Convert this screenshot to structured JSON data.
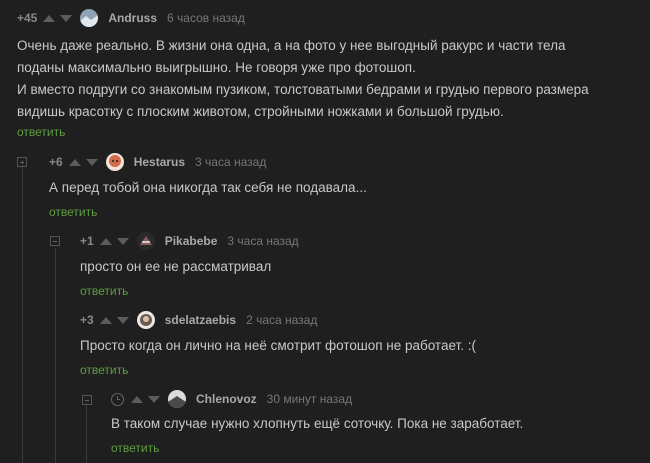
{
  "comments": [
    {
      "score": "+45",
      "author": "Andruss",
      "time": "6 часов назад",
      "lines": [
        "Очень даже реально. В жизни она одна, а на фото у нее выгодный ракурс и части тела",
        "поданы максимально выигрышно. Не говоря уже про фотошоп.",
        "И вместо подруги со знакомым пузиком, толстоватыми бедрами и грудью первого размера",
        "видишь красотку с плоским животом, стройными ножками и большой грудью."
      ],
      "reply": "ответить"
    },
    {
      "score": "+6",
      "author": "Hestarus",
      "time": "3 часа назад",
      "lines": [
        "А перед тобой она никогда так себя не подавала..."
      ],
      "reply": "ответить"
    },
    {
      "score": "+1",
      "author": "Pikabebe",
      "time": "3 часа назад",
      "lines": [
        "просто он ее не рассматривал"
      ],
      "reply": "ответить"
    },
    {
      "score": "+3",
      "author": "sdelatzaebis",
      "time": "2 часа назад",
      "lines": [
        "Просто когда он лично на неё смотрит фотошоп не работает. :("
      ],
      "reply": "ответить"
    },
    {
      "score": "",
      "author": "Chlenovoz",
      "time": "30 минут назад",
      "lines": [
        "В таком случае нужно хлопнуть ещё соточку. Пока не заработает."
      ],
      "reply": "ответить"
    }
  ],
  "colors": {
    "background": "#1f1f1f",
    "reply_link": "#5f9e43",
    "text": "#c8c8c8"
  }
}
